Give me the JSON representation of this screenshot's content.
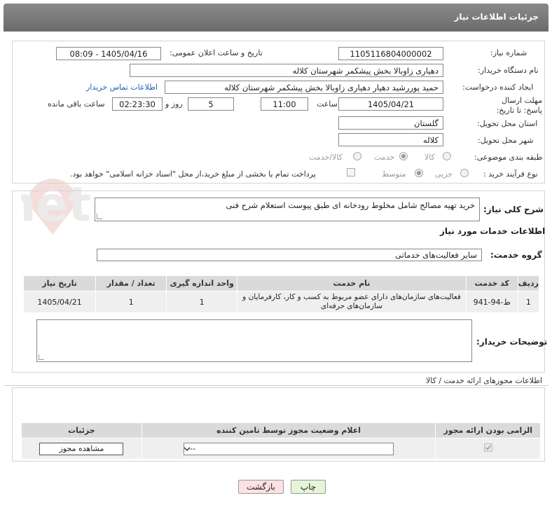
{
  "header": {
    "title": "جزئیات اطلاعات نیاز"
  },
  "form": {
    "need_number_label": "شماره نیاز:",
    "need_number": "1105116804000002",
    "announce_label": "تاریخ و ساعت اعلان عمومی:",
    "announce_value": "1405/04/16 - 08:09",
    "buyer_org_label": "نام دستگاه خریدار:",
    "buyer_org": "دهیاری زاوبالا بخش پیشکمر شهرستان کلاله",
    "creator_label": "ایجاد کننده درخواست:",
    "creator": "حمید پوررشید دهیار دهیاری زاوبالا بخش پیشکمر شهرستان کلاله",
    "contact_link": "اطلاعات تماس خریدار",
    "deadline_label": "مهلت ارسال پاسخ: تا تاریخ:",
    "deadline_date": "1405/04/21",
    "time_label": "ساعت",
    "deadline_time": "11:00",
    "days_value": "5",
    "days_label": "روز و",
    "remaining_time": "02:23:30",
    "remaining_label": "ساعت باقی مانده",
    "province_label": "استان محل تحویل:",
    "province": "گلستان",
    "city_label": "شهر محل تحویل:",
    "city": "کلاله",
    "category_label": "طبقه بندی موضوعی:",
    "category_options": [
      "کالا",
      "خدمت",
      "کالا/خدمت"
    ],
    "category_selected": 1,
    "process_label": "نوع فرآیند خرید :",
    "process_options": [
      "جزیی",
      "متوسط"
    ],
    "process_selected": 1,
    "payment_note": "پرداخت تمام یا بخشی از مبلغ خرید،از محل \"اسناد خزانه اسلامی\" خواهد بود."
  },
  "description": {
    "label": "شرح کلی نیاز:",
    "value": "خرید تهیه مصالح شامل مخلوط رودخانه ای طبق پیوست استعلام شرح فنی"
  },
  "services": {
    "section_title": "اطلاعات خدمات مورد نیاز",
    "group_label": "گروه خدمت:",
    "group_value": "سایر فعالیت‌های خدماتی",
    "columns": [
      "ردیف",
      "کد خدمت",
      "نام خدمت",
      "واحد اندازه گیری",
      "تعداد / مقدار",
      "تاریخ نیاز"
    ],
    "rows": [
      {
        "row": "1",
        "code": "ط-94-941",
        "name": "فعالیت‌های سازمان‌های دارای عضو مربوط به کسب و کار، کارفرمایان و سازمان‌های حرفه‌ای",
        "unit": "1",
        "qty": "1",
        "date": "1405/04/21"
      }
    ]
  },
  "buyer_notes": {
    "label": "توضیحات خریدار:",
    "value": ""
  },
  "permits": {
    "section_title": "اطلاعات مجوزهای ارائه خدمت / کالا",
    "columns": [
      "الزامی بودن ارائه مجوز",
      "اعلام وضعیت مجوز توسط تامین کننده",
      "جزئیات"
    ],
    "select_value": "--",
    "view_button": "مشاهده مجوز"
  },
  "actions": {
    "print": "چاپ",
    "back": "بازگشت"
  },
  "watermark": {
    "text": "AriaTender.net"
  },
  "colors": {
    "header": "#7a7a7a",
    "link": "#1a5fb4",
    "back_btn": "#fde2e2",
    "print_btn": "#e6f4d7"
  }
}
